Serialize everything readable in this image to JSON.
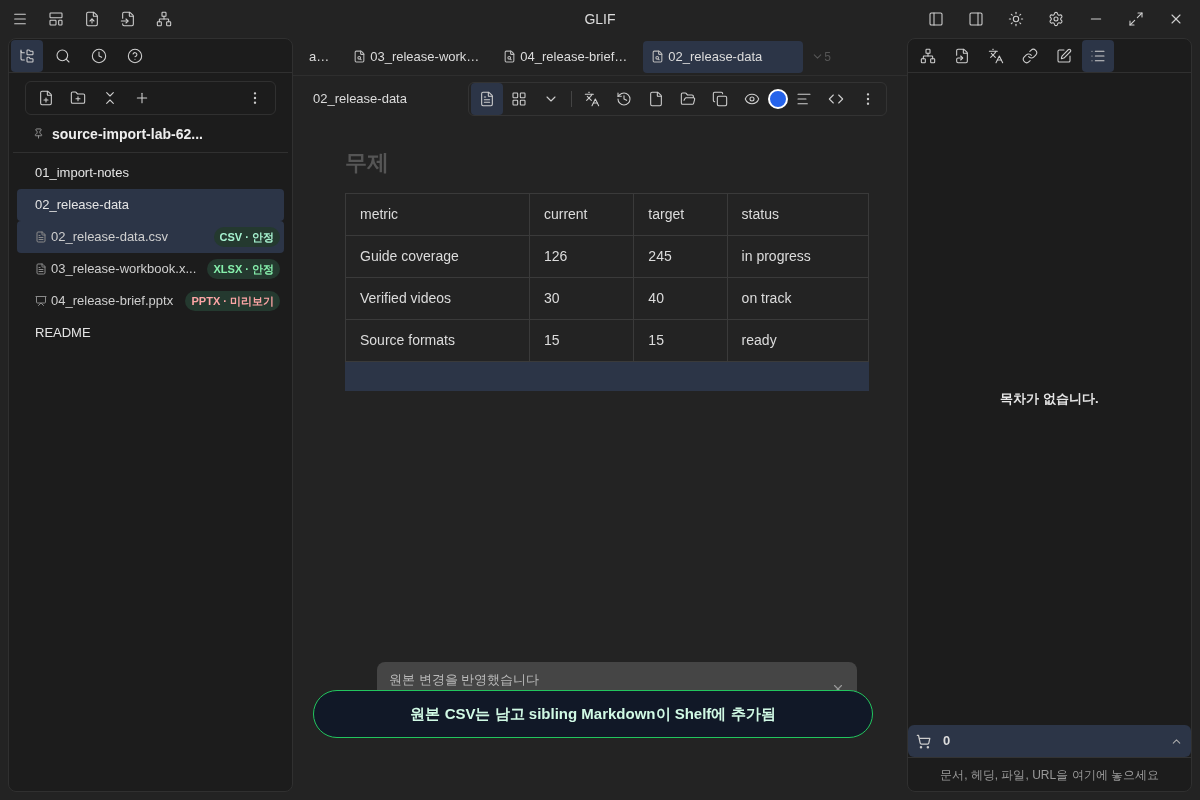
{
  "window": {
    "title": "GLIF"
  },
  "sidebar": {
    "vault": "source-import-lab-62...",
    "items": [
      {
        "kind": "note",
        "label": "01_import-notes",
        "selected": false
      },
      {
        "kind": "note",
        "label": "02_release-data",
        "selected": true
      },
      {
        "kind": "file",
        "label": "02_release-data.csv",
        "selected": true,
        "badge": "CSV · 안정",
        "color": "#a7f3d0"
      },
      {
        "kind": "file",
        "label": "03_release-workbook.x...",
        "selected": false,
        "badge": "XLSX · 안정",
        "color": "#86efac"
      },
      {
        "kind": "slide",
        "label": "04_release-brief.pptx",
        "selected": false,
        "badge": "PPTX · 미리보기",
        "color": "#fca5a5"
      },
      {
        "kind": "note",
        "label": "README",
        "selected": false
      }
    ]
  },
  "tabs": [
    {
      "label": "a…",
      "selected": false
    },
    {
      "label": "03_release-work…",
      "selected": false
    },
    {
      "label": "04_release-brief…",
      "selected": false
    },
    {
      "label": "02_release-data",
      "selected": true
    }
  ],
  "tab_overflow": "5",
  "editor": {
    "breadcrumb": "02_release-data",
    "heading": "무제",
    "table": {
      "columns": [
        "metric",
        "current",
        "target",
        "status"
      ],
      "rows": [
        [
          "Guide coverage",
          "126",
          "245",
          "in progress"
        ],
        [
          "Verified videos",
          "30",
          "40",
          "on track"
        ],
        [
          "Source formats",
          "15",
          "15",
          "ready"
        ]
      ]
    }
  },
  "outline": {
    "empty_text": "목차가 없습니다."
  },
  "shelf": {
    "count": "0",
    "hint": "문서, 헤딩, 파일, URL을 여기에 놓으세요"
  },
  "notification": {
    "text": "원본 변경을 반영했습니다"
  },
  "toast": {
    "text": "원본 CSV는 남고 sibling Markdown이 Shelf에 추가됨"
  }
}
